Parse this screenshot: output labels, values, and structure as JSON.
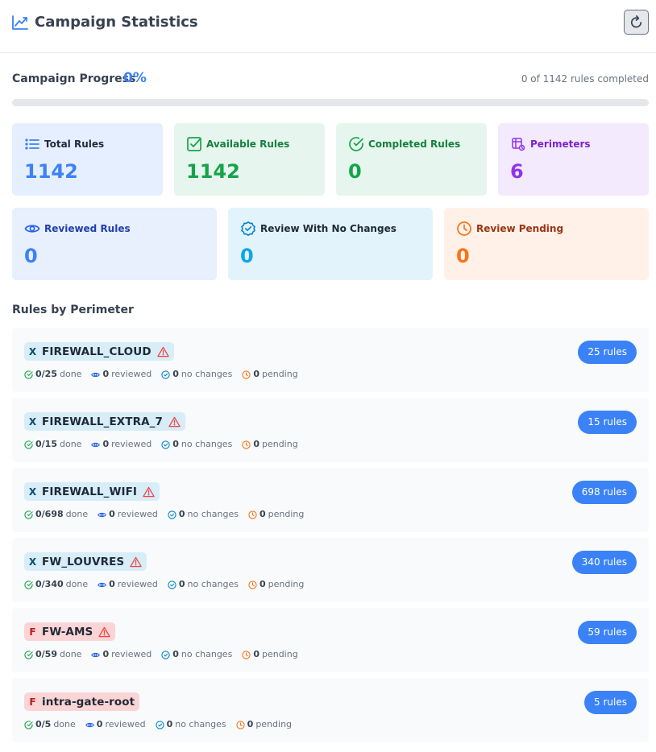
{
  "header": {
    "title": "Campaign Statistics",
    "title_icon": "trend-chart-icon",
    "refresh_icon": "refresh-icon"
  },
  "progress": {
    "label": "Campaign Progress",
    "percent": "0%",
    "fraction": 0,
    "summary": "0 of 1142 rules completed"
  },
  "cards": [
    {
      "key": "total",
      "label": "Total Rules",
      "value": "1142",
      "icon": "list-icon",
      "bg": "#e6efff",
      "label_color": "#1f2937",
      "value_color": "#3b82f6",
      "icon_color": "#3b82f6"
    },
    {
      "key": "available",
      "label": "Available Rules",
      "value": "1142",
      "icon": "checkbox-icon",
      "bg": "#e6f6ee",
      "label_color": "#15803d",
      "value_color": "#16a34a",
      "icon_color": "#16a34a"
    },
    {
      "key": "completed",
      "label": "Completed Rules",
      "value": "0",
      "icon": "check-circle-icon",
      "bg": "#e6f6ee",
      "label_color": "#15803d",
      "value_color": "#16a34a",
      "icon_color": "#16a34a"
    },
    {
      "key": "perimeters",
      "label": "Perimeters",
      "value": "6",
      "icon": "perimeter-icon",
      "bg": "#f3eafe",
      "label_color": "#7e22ce",
      "value_color": "#9333ea",
      "icon_color": "#9333ea"
    },
    {
      "key": "reviewed",
      "label": "Reviewed Rules",
      "value": "0",
      "icon": "eye-icon",
      "bg": "#e8effd",
      "label_color": "#1e40af",
      "value_color": "#3b82f6",
      "icon_color": "#2563eb"
    },
    {
      "key": "nochanges",
      "label": "Review With No Changes",
      "value": "0",
      "icon": "badge-check-icon",
      "bg": "#e2f3fb",
      "label_color": "#1f2937",
      "value_color": "#0ea5e9",
      "icon_color": "#0284c7"
    },
    {
      "key": "pending",
      "label": "Review Pending",
      "value": "0",
      "icon": "clock-icon",
      "bg": "#fff1e8",
      "label_color": "#9a3412",
      "value_color": "#f97316",
      "icon_color": "#f97316"
    }
  ],
  "section": {
    "title": "Rules by Perimeter"
  },
  "perimeters": [
    {
      "name": "FIREWALL_CLOUD",
      "vendor": "X",
      "vendor_icon": "x-vendor-icon",
      "tag_bg": "#d7edf8",
      "vendor_color": "#0c4a6e",
      "warning": true,
      "done": "0/25",
      "done_label": "done",
      "reviewed": "0",
      "reviewed_label": "reviewed",
      "nochanges": "0",
      "nochanges_label": "no changes",
      "pending": "0",
      "pending_label": "pending",
      "rules": "25 rules"
    },
    {
      "name": "FIREWALL_EXTRA_7",
      "vendor": "X",
      "vendor_icon": "x-vendor-icon",
      "tag_bg": "#d7edf8",
      "vendor_color": "#0c4a6e",
      "warning": true,
      "done": "0/15",
      "done_label": "done",
      "reviewed": "0",
      "reviewed_label": "reviewed",
      "nochanges": "0",
      "nochanges_label": "no changes",
      "pending": "0",
      "pending_label": "pending",
      "rules": "15 rules"
    },
    {
      "name": "FIREWALL_WIFI",
      "vendor": "X",
      "vendor_icon": "x-vendor-icon",
      "tag_bg": "#d7edf8",
      "vendor_color": "#0c4a6e",
      "warning": true,
      "done": "0/698",
      "done_label": "done",
      "reviewed": "0",
      "reviewed_label": "reviewed",
      "nochanges": "0",
      "nochanges_label": "no changes",
      "pending": "0",
      "pending_label": "pending",
      "rules": "698 rules"
    },
    {
      "name": "FW_LOUVRES",
      "vendor": "X",
      "vendor_icon": "x-vendor-icon",
      "tag_bg": "#d7edf8",
      "vendor_color": "#0c4a6e",
      "warning": true,
      "done": "0/340",
      "done_label": "done",
      "reviewed": "0",
      "reviewed_label": "reviewed",
      "nochanges": "0",
      "nochanges_label": "no changes",
      "pending": "0",
      "pending_label": "pending",
      "rules": "340 rules"
    },
    {
      "name": "FW-AMS",
      "vendor": "F",
      "vendor_icon": "f-vendor-icon",
      "tag_bg": "#fbd5d5",
      "vendor_color": "#b91c1c",
      "warning": true,
      "done": "0/59",
      "done_label": "done",
      "reviewed": "0",
      "reviewed_label": "reviewed",
      "nochanges": "0",
      "nochanges_label": "no changes",
      "pending": "0",
      "pending_label": "pending",
      "rules": "59 rules"
    },
    {
      "name": "intra-gate-root",
      "vendor": "F",
      "vendor_icon": "f-vendor-icon",
      "tag_bg": "#fbd5d5",
      "vendor_color": "#b91c1c",
      "warning": false,
      "done": "0/5",
      "done_label": "done",
      "reviewed": "0",
      "reviewed_label": "reviewed",
      "nochanges": "0",
      "nochanges_label": "no changes",
      "pending": "0",
      "pending_label": "pending",
      "rules": "5 rules"
    }
  ]
}
